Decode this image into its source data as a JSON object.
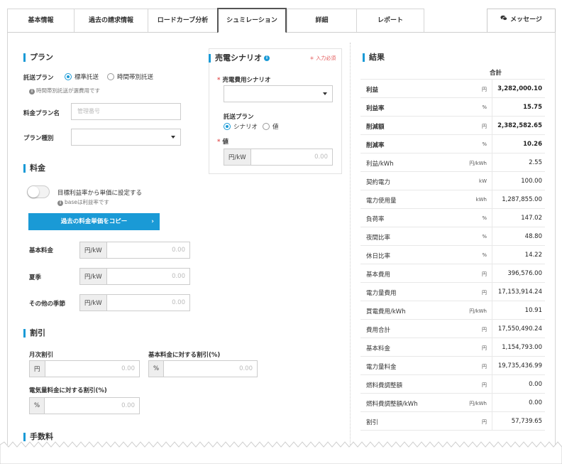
{
  "tabs": [
    {
      "label": "基本情報"
    },
    {
      "label": "過去の請求情報"
    },
    {
      "label": "ロードカーブ分析"
    },
    {
      "label": "シュミレーション"
    },
    {
      "label": "詳細"
    },
    {
      "label": "レポート"
    }
  ],
  "message_button": {
    "label": "メッセージ",
    "icon": "chat-icon"
  },
  "plan": {
    "title": "プラン",
    "transmission_label": "託送プラン",
    "options": [
      "標準託送",
      "時間帯別託送"
    ],
    "note": "時間帯別託送が選費用です",
    "price_plan_label": "料金プラン名",
    "price_plan_placeholder": "管理番号",
    "plan_type_label": "プラン種別"
  },
  "pricing": {
    "title": "料金",
    "toggle_label": "目標利益率から単価に設定する",
    "toggle_note": "baseは利益率です",
    "copy_button": "過去の料金単価をコピー",
    "rows": [
      {
        "label": "基本料金",
        "unit": "円/kW",
        "value": "0.00"
      },
      {
        "label": "夏季",
        "unit": "円/kW",
        "value": "0.00"
      },
      {
        "label": "その他の季節",
        "unit": "円/kW",
        "value": "0.00"
      }
    ]
  },
  "discount": {
    "title": "割引",
    "monthly_label": "月次割引",
    "monthly_unit": "円",
    "monthly_value": "0.00",
    "base_label": "基本料金に対する割引(%)",
    "base_unit": "%",
    "base_value": "0.00",
    "energy_label": "電気量料金に対する割引(%)",
    "energy_unit": "%",
    "energy_value": "0.00"
  },
  "fees": {
    "title": "手数料"
  },
  "scenario": {
    "title": "売電シナリオ",
    "required_note": "＊ 入力必須",
    "cost_label": "売電費用シナリオ",
    "transmission_label": "託送プラン",
    "options": [
      "シナリオ",
      "値"
    ],
    "value_label": "値",
    "value_unit": "円/kW",
    "value_value": "0.00"
  },
  "results": {
    "title": "結果",
    "column": "合計",
    "rows": [
      {
        "name": "利益",
        "unit": "円",
        "value": "3,282,000.10",
        "bold": true
      },
      {
        "name": "利益率",
        "unit": "%",
        "value": "15.75",
        "bold": true
      },
      {
        "name": "削減額",
        "unit": "円",
        "value": "2,382,582.65",
        "bold": true
      },
      {
        "name": "削減率",
        "unit": "%",
        "value": "10.26",
        "bold": true
      },
      {
        "name": "利益/kWh",
        "unit": "円/kWh",
        "value": "2.55",
        "bold": false
      },
      {
        "name": "契約電力",
        "unit": "kW",
        "value": "100.00",
        "bold": false
      },
      {
        "name": "電力使用量",
        "unit": "kWh",
        "value": "1,287,855.00",
        "bold": false
      },
      {
        "name": "負荷率",
        "unit": "%",
        "value": "147.02",
        "bold": false
      },
      {
        "name": "夜間比率",
        "unit": "%",
        "value": "48.80",
        "bold": false
      },
      {
        "name": "休日比率",
        "unit": "%",
        "value": "14.22",
        "bold": false
      },
      {
        "name": "基本費用",
        "unit": "円",
        "value": "396,576.00",
        "bold": false
      },
      {
        "name": "電力量費用",
        "unit": "円",
        "value": "17,153,914.24",
        "bold": false
      },
      {
        "name": "買電費用/kWh",
        "unit": "円/kWh",
        "value": "10.91",
        "bold": false
      },
      {
        "name": "費用合計",
        "unit": "円",
        "value": "17,550,490.24",
        "bold": false
      },
      {
        "name": "基本料金",
        "unit": "円",
        "value": "1,154,793.00",
        "bold": false
      },
      {
        "name": "電力量料金",
        "unit": "円",
        "value": "19,735,436.99",
        "bold": false
      },
      {
        "name": "燃料費調整額",
        "unit": "円",
        "value": "0.00",
        "bold": false
      },
      {
        "name": "燃料費調整額/kWh",
        "unit": "円/kWh",
        "value": "0.00",
        "bold": false
      },
      {
        "name": "割引",
        "unit": "円",
        "value": "57,739.65",
        "bold": false
      }
    ]
  },
  "colors": {
    "accent": "#1a9ad6",
    "required": "#e35a5a"
  }
}
